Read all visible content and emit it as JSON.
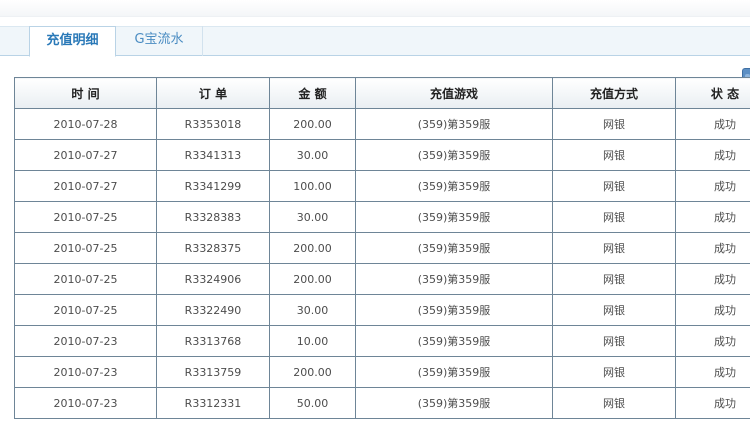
{
  "tabs": [
    {
      "label": "充值明细",
      "active": true
    },
    {
      "label": "G宝流水",
      "active": false
    }
  ],
  "table": {
    "headers": [
      "时 间",
      "订 单",
      "金 额",
      "充值游戏",
      "充值方式",
      "状 态"
    ],
    "rows": [
      [
        "2010-07-28",
        "R3353018",
        "200.00",
        "(359)第359服",
        "网银",
        "成功"
      ],
      [
        "2010-07-27",
        "R3341313",
        "30.00",
        "(359)第359服",
        "网银",
        "成功"
      ],
      [
        "2010-07-27",
        "R3341299",
        "100.00",
        "(359)第359服",
        "网银",
        "成功"
      ],
      [
        "2010-07-25",
        "R3328383",
        "30.00",
        "(359)第359服",
        "网银",
        "成功"
      ],
      [
        "2010-07-25",
        "R3328375",
        "200.00",
        "(359)第359服",
        "网银",
        "成功"
      ],
      [
        "2010-07-25",
        "R3324906",
        "200.00",
        "(359)第359服",
        "网银",
        "成功"
      ],
      [
        "2010-07-25",
        "R3322490",
        "30.00",
        "(359)第359服",
        "网银",
        "成功"
      ],
      [
        "2010-07-23",
        "R3313768",
        "10.00",
        "(359)第359服",
        "网银",
        "成功"
      ],
      [
        "2010-07-23",
        "R3313759",
        "200.00",
        "(359)第359服",
        "网银",
        "成功"
      ],
      [
        "2010-07-23",
        "R3312331",
        "50.00",
        "(359)第359服",
        "网银",
        "成功"
      ]
    ]
  },
  "colors": {
    "tab_active_text": "#2a79b8",
    "tab_inactive_text": "#4a8cc2",
    "table_border": "#6e8597",
    "side_handle": "#5c8fc4"
  }
}
